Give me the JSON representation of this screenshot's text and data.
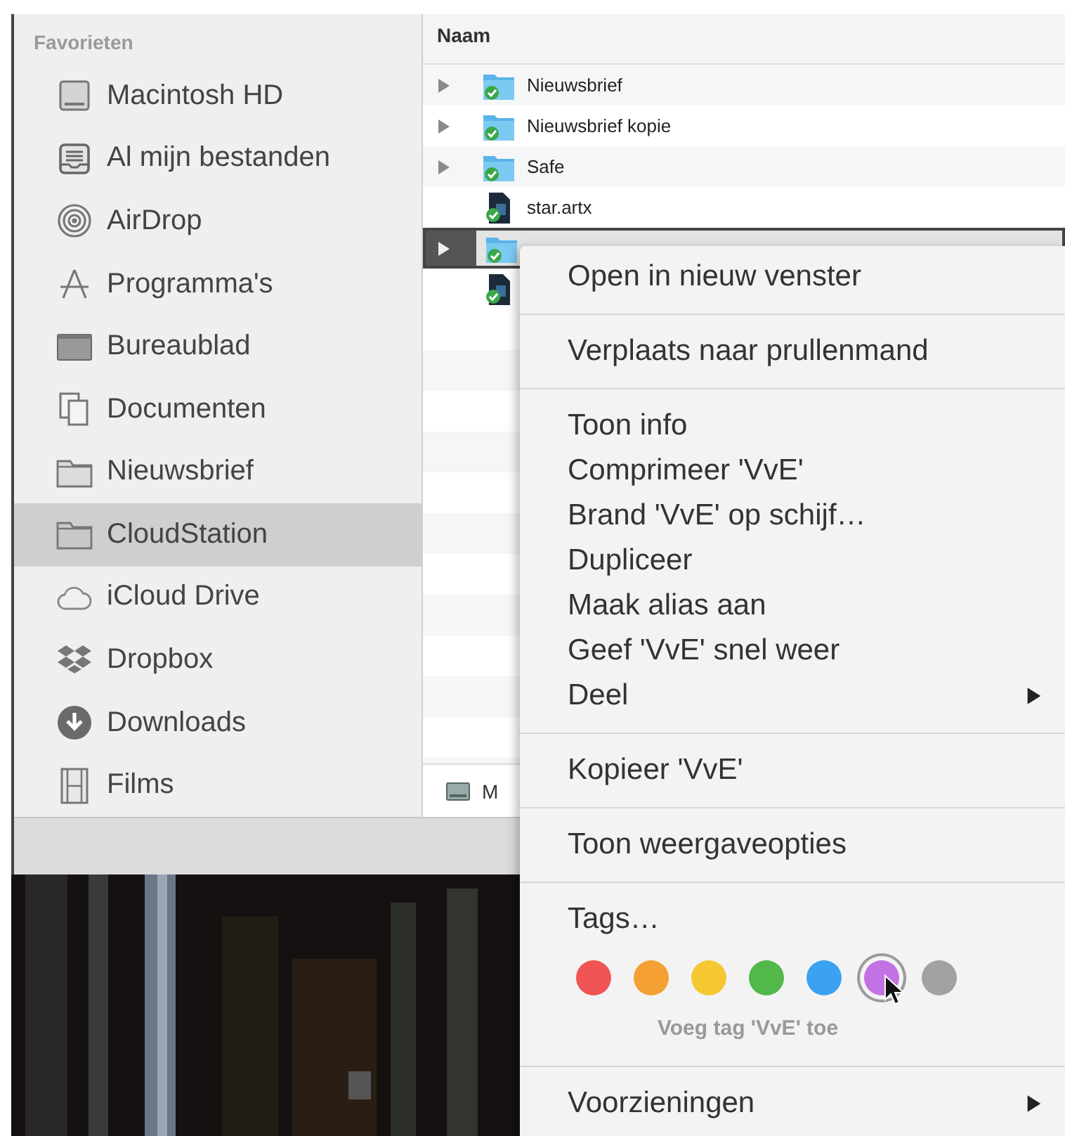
{
  "sidebar": {
    "heading": "Favorieten",
    "items": [
      {
        "label": "Macintosh HD",
        "selected": false
      },
      {
        "label": "Al mijn bestanden",
        "selected": false
      },
      {
        "label": "AirDrop",
        "selected": false
      },
      {
        "label": "Programma's",
        "selected": false
      },
      {
        "label": "Bureaublad",
        "selected": false
      },
      {
        "label": "Documenten",
        "selected": false
      },
      {
        "label": "Nieuwsbrief",
        "selected": false
      },
      {
        "label": "CloudStation",
        "selected": true
      },
      {
        "label": "iCloud Drive",
        "selected": false
      },
      {
        "label": "Dropbox",
        "selected": false
      },
      {
        "label": "Downloads",
        "selected": false
      },
      {
        "label": "Films",
        "selected": false
      }
    ]
  },
  "file_list": {
    "column": "Naam",
    "rows": [
      {
        "kind": "folder",
        "name": "Nieuwsbrief",
        "selected": false
      },
      {
        "kind": "folder",
        "name": "Nieuwsbrief kopie",
        "selected": false
      },
      {
        "kind": "folder",
        "name": "Safe",
        "selected": false
      },
      {
        "kind": "file",
        "name": "star.artx",
        "selected": false
      },
      {
        "kind": "folder",
        "selected": true
      },
      {
        "kind": "file",
        "selected": false
      }
    ],
    "path_bar": "M"
  },
  "context_menu": {
    "sections": [
      [
        {
          "kind": "item",
          "label": "Open in nieuw venster",
          "submenu": false
        }
      ],
      [
        {
          "kind": "item",
          "label": "Verplaats naar prullenmand",
          "submenu": false
        }
      ],
      [
        {
          "kind": "item",
          "label": "Toon info",
          "submenu": false
        },
        {
          "kind": "item",
          "label": "Comprimeer 'VvE'",
          "submenu": false
        },
        {
          "kind": "item",
          "label": "Brand 'VvE' op schijf…",
          "submenu": false
        },
        {
          "kind": "item",
          "label": "Dupliceer",
          "submenu": false
        },
        {
          "kind": "item",
          "label": "Maak alias aan",
          "submenu": false
        },
        {
          "kind": "item",
          "label": "Geef 'VvE' snel weer",
          "submenu": false
        },
        {
          "kind": "item",
          "label": "Deel",
          "submenu": true
        }
      ],
      [
        {
          "kind": "item",
          "label": "Kopieer 'VvE'",
          "submenu": false
        }
      ],
      [
        {
          "kind": "item",
          "label": "Toon weergaveopties",
          "submenu": false
        }
      ],
      [
        {
          "kind": "tags",
          "label": "Tags…",
          "hint": "Voeg tag 'VvE' toe",
          "colors": [
            {
              "color": "#f05454",
              "selected": false
            },
            {
              "color": "#f5a032",
              "selected": false
            },
            {
              "color": "#f5c832",
              "selected": false
            },
            {
              "color": "#52b84a",
              "selected": false
            },
            {
              "color": "#3aa2f0",
              "selected": false
            },
            {
              "color": "#c272e2",
              "selected": true
            },
            {
              "color": "#a2a2a2",
              "selected": false
            }
          ]
        }
      ],
      [
        {
          "kind": "item",
          "label": "Voorzieningen",
          "submenu": true
        }
      ]
    ]
  }
}
